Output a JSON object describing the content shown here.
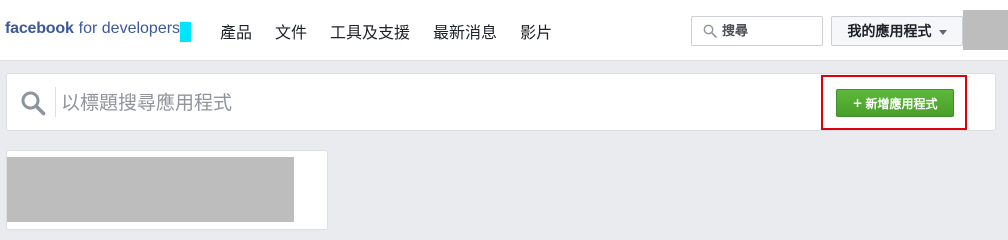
{
  "header": {
    "logo_brand": "facebook",
    "logo_suffix": "for developers",
    "nav": [
      {
        "label": "產品"
      },
      {
        "label": "文件"
      },
      {
        "label": "工具及支援"
      },
      {
        "label": "最新消息"
      },
      {
        "label": "影片"
      }
    ],
    "search_placeholder": "搜尋",
    "my_apps_label": "我的應用程式"
  },
  "app_search": {
    "placeholder": "以標題搜尋應用程式",
    "add_button_label": "新增應用程式",
    "add_button_prefix": "+"
  },
  "colors": {
    "brand": "#3b5998",
    "accent_green": "#4cae4c",
    "highlight_red": "#e0000b",
    "page_bg": "#e9ebee"
  }
}
